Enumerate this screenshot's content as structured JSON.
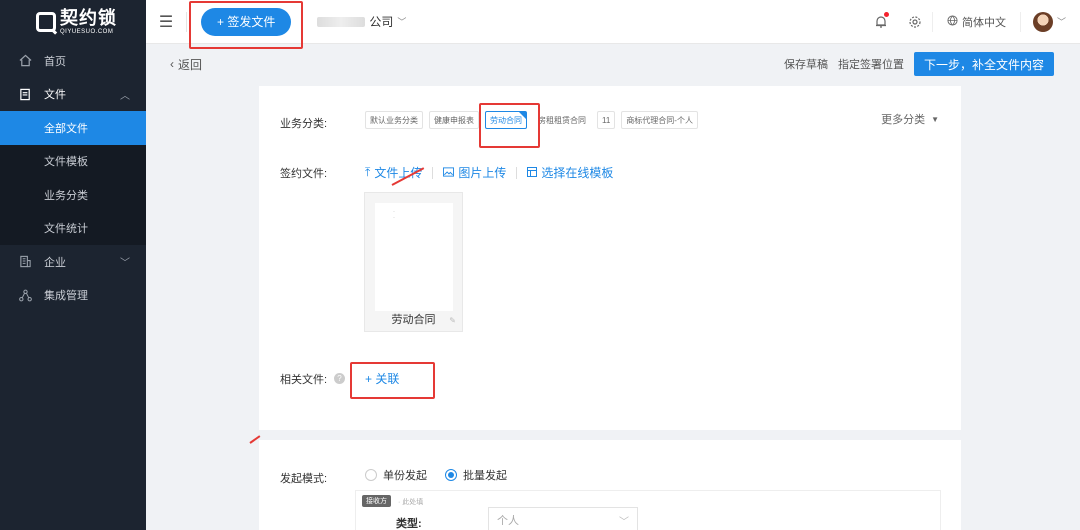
{
  "brand": {
    "name": "契约锁",
    "sub": "QIYUESUO.COM"
  },
  "sidebar": {
    "items": [
      {
        "label": "首页"
      },
      {
        "label": "文件"
      },
      {
        "label": "全部文件"
      },
      {
        "label": "文件模板"
      },
      {
        "label": "业务分类"
      },
      {
        "label": "文件统计"
      },
      {
        "label": "企业"
      },
      {
        "label": "集成管理"
      }
    ]
  },
  "topbar": {
    "new_doc_label": "+ 签发文件",
    "company_suffix": "公司",
    "language": "简体中文"
  },
  "subheader": {
    "back_label": "返回",
    "save_draft": "保存草稿",
    "set_sign_position": "指定签署位置",
    "next_step": "下一步，补全文件内容"
  },
  "form": {
    "category_label": "业务分类:",
    "categories": [
      "默认业务分类",
      "健康申报表",
      "劳动合同",
      "房租租赁合同",
      "11",
      "商标代理合同-个人"
    ],
    "more_categories": "更多分类",
    "sign_file_label": "签约文件:",
    "upload_file": "文件上传",
    "upload_image": "图片上传",
    "choose_template": "选择在线模板",
    "file_name": "劳动合同",
    "related_label": "相关文件:",
    "link_label": "+ 关联",
    "mode_label": "发起模式:",
    "mode_single": "单份发起",
    "mode_batch": "批量发起",
    "recv_badge": "接收方",
    "recv_hint": "· 此处填",
    "type_label": "类型:",
    "type_value": "个人"
  }
}
